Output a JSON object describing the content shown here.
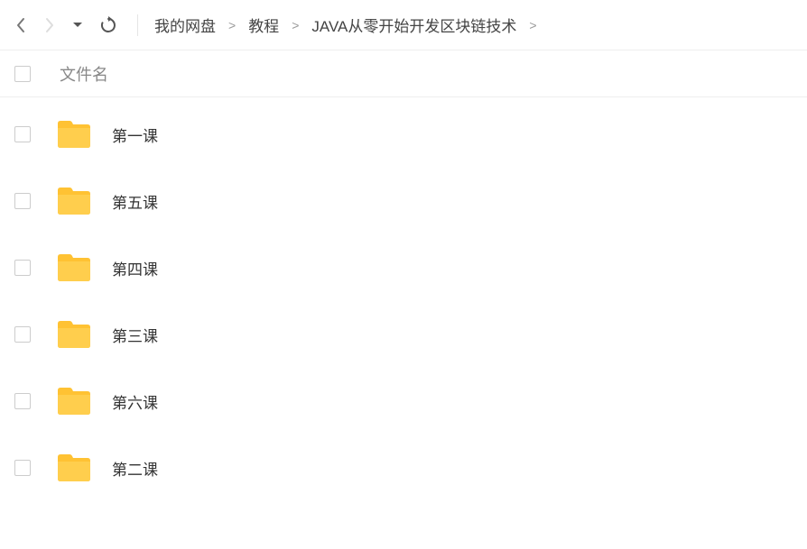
{
  "breadcrumb": {
    "items": [
      {
        "label": "我的网盘"
      },
      {
        "label": "教程"
      },
      {
        "label": "JAVA从零开始开发区块链技术"
      }
    ],
    "trailing_sep": true
  },
  "columns": {
    "filename_label": "文件名"
  },
  "files": [
    {
      "name": "第一课",
      "type": "folder"
    },
    {
      "name": "第五课",
      "type": "folder"
    },
    {
      "name": "第四课",
      "type": "folder"
    },
    {
      "name": "第三课",
      "type": "folder"
    },
    {
      "name": "第六课",
      "type": "folder"
    },
    {
      "name": "第二课",
      "type": "folder"
    }
  ]
}
